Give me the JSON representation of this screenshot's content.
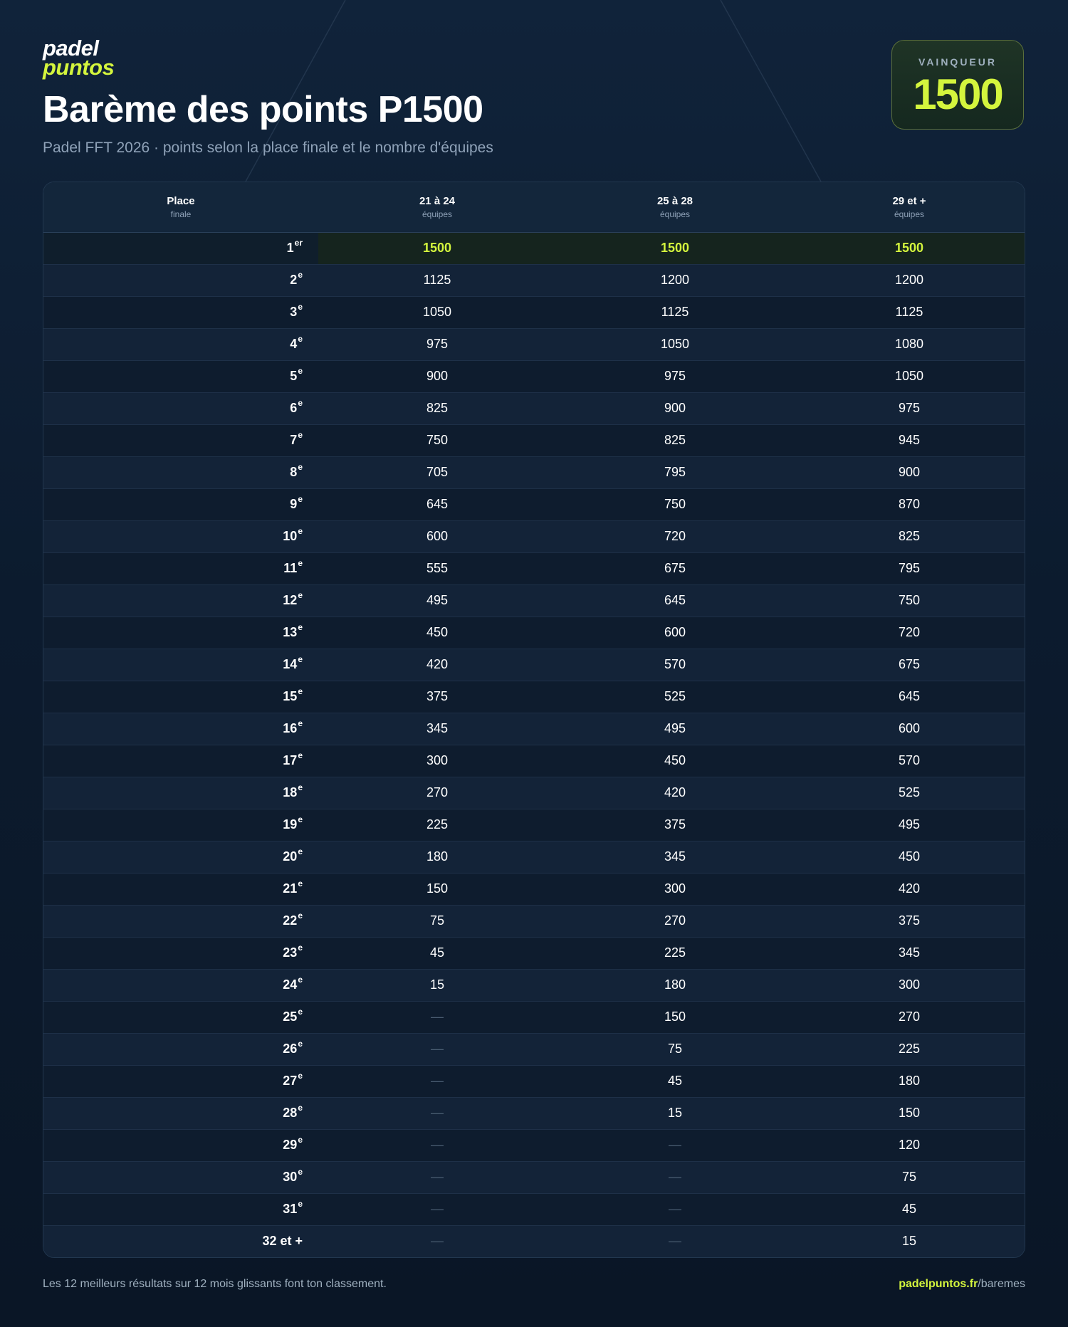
{
  "brand": {
    "line1": "padel",
    "line2": "puntos"
  },
  "title": "Barème des points P1500",
  "subtitle": "Padel FFT 2026 · points selon la place finale et le nombre d'équipes",
  "winner": {
    "label": "VAINQUEUR",
    "value": "1500"
  },
  "colors": {
    "accent": "#d4f53d",
    "background": "#0c1b2e"
  },
  "table": {
    "headers": [
      {
        "main": "Place",
        "sub": "finale"
      },
      {
        "main": "21 à 24",
        "sub": "équipes"
      },
      {
        "main": "25 à 28",
        "sub": "équipes"
      },
      {
        "main": "29 et +",
        "sub": "équipes"
      }
    ],
    "rows": [
      {
        "place": "1",
        "suffix": "er",
        "values": [
          "1500",
          "1500",
          "1500"
        ]
      },
      {
        "place": "2",
        "suffix": "e",
        "values": [
          "1125",
          "1200",
          "1200"
        ]
      },
      {
        "place": "3",
        "suffix": "e",
        "values": [
          "1050",
          "1125",
          "1125"
        ]
      },
      {
        "place": "4",
        "suffix": "e",
        "values": [
          "975",
          "1050",
          "1080"
        ]
      },
      {
        "place": "5",
        "suffix": "e",
        "values": [
          "900",
          "975",
          "1050"
        ]
      },
      {
        "place": "6",
        "suffix": "e",
        "values": [
          "825",
          "900",
          "975"
        ]
      },
      {
        "place": "7",
        "suffix": "e",
        "values": [
          "750",
          "825",
          "945"
        ]
      },
      {
        "place": "8",
        "suffix": "e",
        "values": [
          "705",
          "795",
          "900"
        ]
      },
      {
        "place": "9",
        "suffix": "e",
        "values": [
          "645",
          "750",
          "870"
        ]
      },
      {
        "place": "10",
        "suffix": "e",
        "values": [
          "600",
          "720",
          "825"
        ]
      },
      {
        "place": "11",
        "suffix": "e",
        "values": [
          "555",
          "675",
          "795"
        ]
      },
      {
        "place": "12",
        "suffix": "e",
        "values": [
          "495",
          "645",
          "750"
        ]
      },
      {
        "place": "13",
        "suffix": "e",
        "values": [
          "450",
          "600",
          "720"
        ]
      },
      {
        "place": "14",
        "suffix": "e",
        "values": [
          "420",
          "570",
          "675"
        ]
      },
      {
        "place": "15",
        "suffix": "e",
        "values": [
          "375",
          "525",
          "645"
        ]
      },
      {
        "place": "16",
        "suffix": "e",
        "values": [
          "345",
          "495",
          "600"
        ]
      },
      {
        "place": "17",
        "suffix": "e",
        "values": [
          "300",
          "450",
          "570"
        ]
      },
      {
        "place": "18",
        "suffix": "e",
        "values": [
          "270",
          "420",
          "525"
        ]
      },
      {
        "place": "19",
        "suffix": "e",
        "values": [
          "225",
          "375",
          "495"
        ]
      },
      {
        "place": "20",
        "suffix": "e",
        "values": [
          "180",
          "345",
          "450"
        ]
      },
      {
        "place": "21",
        "suffix": "e",
        "values": [
          "150",
          "300",
          "420"
        ]
      },
      {
        "place": "22",
        "suffix": "e",
        "values": [
          "75",
          "270",
          "375"
        ]
      },
      {
        "place": "23",
        "suffix": "e",
        "values": [
          "45",
          "225",
          "345"
        ]
      },
      {
        "place": "24",
        "suffix": "e",
        "values": [
          "15",
          "180",
          "300"
        ]
      },
      {
        "place": "25",
        "suffix": "e",
        "values": [
          "—",
          "150",
          "270"
        ]
      },
      {
        "place": "26",
        "suffix": "e",
        "values": [
          "—",
          "75",
          "225"
        ]
      },
      {
        "place": "27",
        "suffix": "e",
        "values": [
          "—",
          "45",
          "180"
        ]
      },
      {
        "place": "28",
        "suffix": "e",
        "values": [
          "—",
          "15",
          "150"
        ]
      },
      {
        "place": "29",
        "suffix": "e",
        "values": [
          "—",
          "—",
          "120"
        ]
      },
      {
        "place": "30",
        "suffix": "e",
        "values": [
          "—",
          "—",
          "75"
        ]
      },
      {
        "place": "31",
        "suffix": "e",
        "values": [
          "—",
          "—",
          "45"
        ]
      },
      {
        "place": "32 et +",
        "suffix": "",
        "values": [
          "—",
          "—",
          "15"
        ]
      }
    ]
  },
  "footer": {
    "note": "Les 12 meilleurs résultats sur 12 mois glissants font ton classement.",
    "link_host": "padelpuntos.fr",
    "link_path": "/baremes"
  }
}
